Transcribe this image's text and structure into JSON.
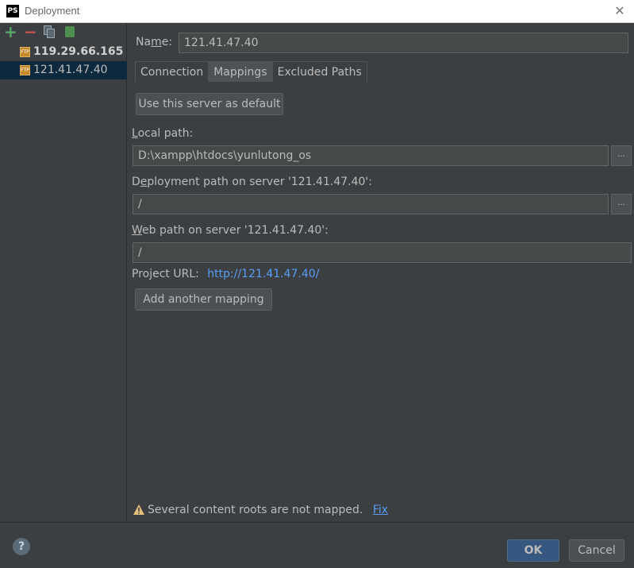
{
  "window": {
    "app_icon": "PS",
    "title": "Deployment"
  },
  "toolbar": {
    "add_icon": "plus-icon",
    "remove_icon": "minus-icon",
    "copy_icon": "copy-icon",
    "default_icon": "use-as-default-icon"
  },
  "servers": [
    {
      "label": "119.29.66.165",
      "bold": true,
      "selected": false,
      "icon": "ftp-server-icon"
    },
    {
      "label": "121.41.47.40",
      "bold": false,
      "selected": true,
      "icon": "ftp-server-icon"
    }
  ],
  "name": {
    "label_pre": "Na",
    "label_mnemonic": "m",
    "label_post": "e:",
    "value": "121.41.47.40"
  },
  "tabs": [
    {
      "label": "Connection",
      "active": false
    },
    {
      "label": "Mappings",
      "active": true
    },
    {
      "label": "Excluded Paths",
      "active": false
    }
  ],
  "mappings": {
    "default_button": "Use this server as default",
    "local_path_mnemonic": "L",
    "local_path_label": "ocal path:",
    "local_path_value": "D:\\xampp\\htdocs\\yunlutong_os",
    "deploy_path_pre": "D",
    "deploy_path_mnemonic": "e",
    "deploy_path_label": "ployment path on server '121.41.47.40':",
    "deploy_path_value": "/",
    "web_path_mnemonic": "W",
    "web_path_label": "eb path on server '121.41.47.40':",
    "web_path_value": "/",
    "project_url_label": "Project URL:",
    "project_url_value": "http://121.41.47.40/",
    "add_mapping_button": "Add another mapping",
    "browse_label": "..."
  },
  "warning": {
    "text": "Several content roots are not mapped.",
    "fix_link": "Fix"
  },
  "footer": {
    "help": "?",
    "ok": "OK",
    "cancel": "Cancel"
  },
  "colors": {
    "background": "#3c3f41",
    "selection": "#0d293e",
    "link": "#589df6",
    "ok_button": "#365880",
    "warning": "#e5c07b"
  }
}
